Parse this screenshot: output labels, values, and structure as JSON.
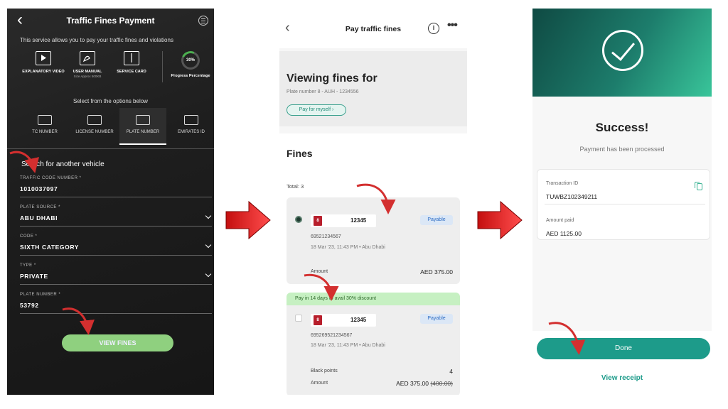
{
  "screen1": {
    "title": "Traffic Fines Payment",
    "description": "This service allows you to pay your traffic fines and violations",
    "tools": [
      {
        "label": "EXPLANATORY VIDEO",
        "sub": ""
      },
      {
        "label": "USER MANUAL",
        "sub": "Size Approx 500KB"
      },
      {
        "label": "SERVICE CARD",
        "sub": ""
      }
    ],
    "progress_value": "30%",
    "progress_label": "Progress Percentage",
    "options_title": "Select from the options below",
    "tabs": [
      {
        "label": "TC NUMBER"
      },
      {
        "label": "LICENSE NUMBER"
      },
      {
        "label": "PLATE NUMBER"
      },
      {
        "label": "EMIRATES ID"
      }
    ],
    "active_tab": "PLATE NUMBER",
    "search_title": "Search for another vehicle",
    "fields": [
      {
        "label": "TRAFFIC CODE NUMBER *",
        "value": "1010037097"
      },
      {
        "label": "PLATE SOURCE *",
        "value": "ABU DHABI"
      },
      {
        "label": "CODE *",
        "value": "SIXTH CATEGORY"
      },
      {
        "label": "TYPE *",
        "value": "PRIVATE"
      },
      {
        "label": "PLATE NUMBER *",
        "value": "53792"
      }
    ],
    "view_fines_label": "VIEW FINES"
  },
  "screen2": {
    "title": "Pay traffic fines",
    "info_glyph": "i",
    "more_glyph": "•••",
    "viewing_title": "Viewing fines for",
    "plate_info": "Plate number 8 - AUH - 1234556",
    "pay_for_myself": "Pay for myself",
    "fines_heading": "Fines",
    "total": "Total: 3",
    "discount_banner": "Pay in 14 days to avail 30% discount",
    "cards": [
      {
        "plate_code": "8",
        "plate_number": "12345",
        "badge": "Payable",
        "reference": "69521234567",
        "datetime": "18 Mar '23, 11:43 PM • Abu Dhabi",
        "amount_label": "Amount",
        "amount_value": "AED 375.00"
      },
      {
        "plate_code": "8",
        "plate_number": "12345",
        "badge": "Payable",
        "reference": "695269521234567",
        "datetime": "18 Mar '23, 11:43 PM • Abu Dhabi",
        "black_points_label": "Black points",
        "black_points_value": "4",
        "amount_label": "Amount",
        "amount_value": "AED 375.00",
        "amount_original": "(400.00)"
      }
    ]
  },
  "screen3": {
    "title": "Success!",
    "subtitle": "Payment has been processed",
    "transaction_label": "Transaction ID",
    "transaction_value": "TUWBZ102349211",
    "amount_label": "Amount paid",
    "amount_value": "AED 1125.00",
    "done_label": "Done",
    "receipt_label": "View receipt"
  },
  "colors": {
    "accent_green": "#1d9b8a",
    "view_fines_green": "#8fd07f",
    "payable_blue": "#2d6cc4",
    "flow_arrow_red": "#d81818",
    "annotation_red": "#d32f2f"
  }
}
